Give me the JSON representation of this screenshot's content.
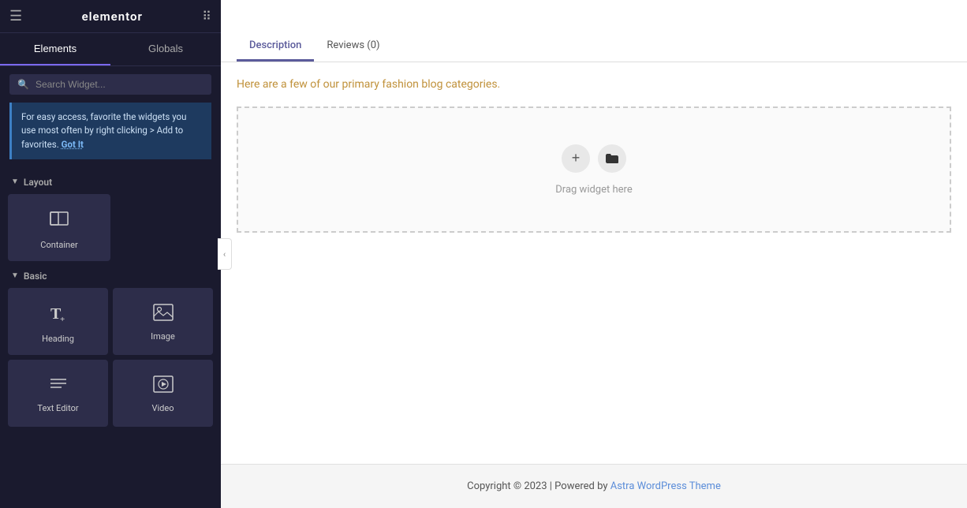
{
  "sidebar": {
    "logo": "elementor",
    "tabs": [
      {
        "id": "elements",
        "label": "Elements",
        "active": true
      },
      {
        "id": "globals",
        "label": "Globals",
        "active": false
      }
    ],
    "search": {
      "placeholder": "Search Widget..."
    },
    "tip": {
      "text": "For easy access, favorite the widgets you use most often by right clicking > Add to favorites.",
      "link_label": "Got It"
    },
    "sections": [
      {
        "id": "layout",
        "label": "Layout",
        "widgets": [
          {
            "id": "container",
            "label": "Container",
            "icon": "container"
          }
        ]
      },
      {
        "id": "basic",
        "label": "Basic",
        "widgets": [
          {
            "id": "heading",
            "label": "Heading",
            "icon": "heading"
          },
          {
            "id": "image",
            "label": "Image",
            "icon": "image"
          },
          {
            "id": "text-editor",
            "label": "Text Editor",
            "icon": "text-editor"
          },
          {
            "id": "video",
            "label": "Video",
            "icon": "video"
          }
        ]
      }
    ]
  },
  "canvas": {
    "product_tabs": [
      {
        "id": "description",
        "label": "Description",
        "active": true
      },
      {
        "id": "reviews",
        "label": "Reviews (0)",
        "active": false
      }
    ],
    "description_text": "Here are a few of our primary fashion blog categories.",
    "drop_zone": {
      "drag_text": "Drag widget here"
    },
    "footer": {
      "text": "Copyright © 2023 | Powered by ",
      "link_text": "Astra WordPress Theme",
      "link_href": "#"
    }
  }
}
